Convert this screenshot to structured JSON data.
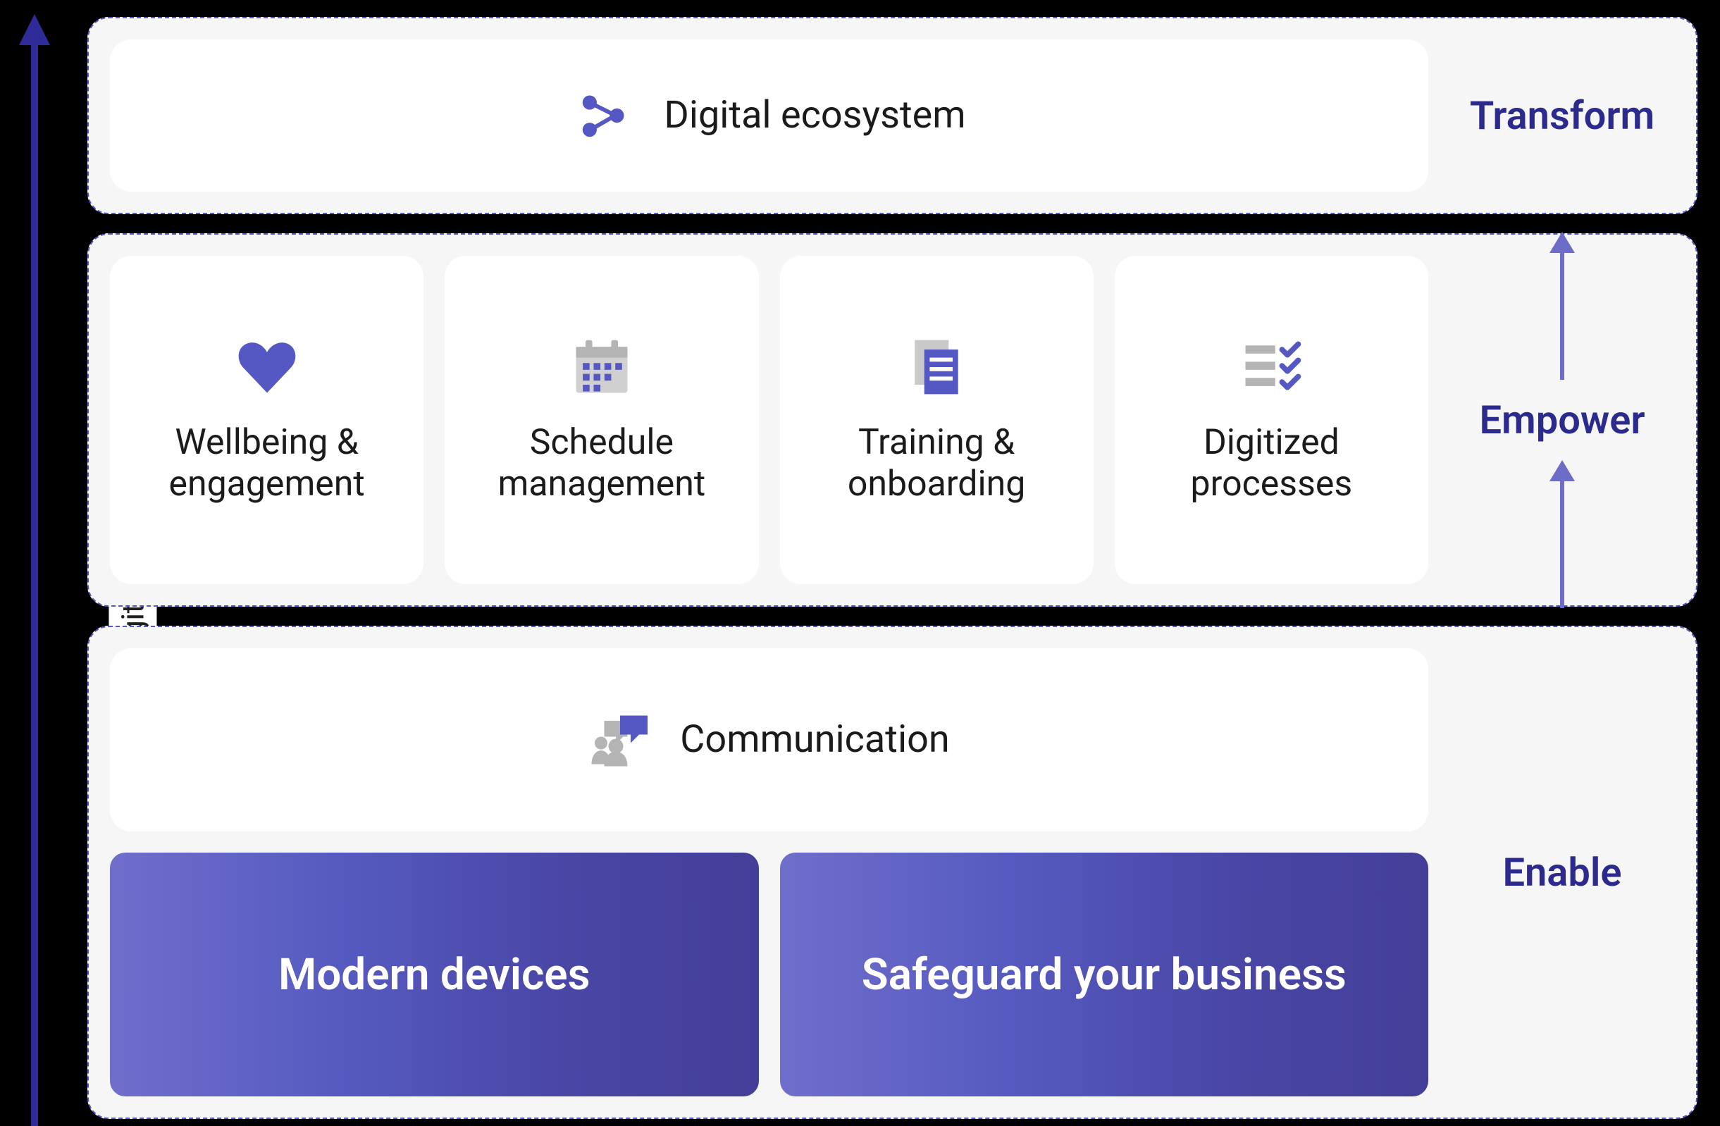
{
  "axis": {
    "label": "Digital maturity"
  },
  "layers": {
    "transform": {
      "label": "Transform",
      "card": {
        "title": "Digital ecosystem",
        "icon": "share-nodes-icon"
      }
    },
    "empower": {
      "label": "Empower",
      "cards": [
        {
          "title": "Wellbeing & engagement",
          "icon": "heart-icon"
        },
        {
          "title": "Schedule management",
          "icon": "calendar-icon"
        },
        {
          "title": "Training & onboarding",
          "icon": "document-icon"
        },
        {
          "title": "Digitized processes",
          "icon": "checklist-icon"
        }
      ]
    },
    "enable": {
      "label": "Enable",
      "card": {
        "title": "Communication",
        "icon": "chat-icon"
      },
      "bars": [
        {
          "title": "Modern devices"
        },
        {
          "title": "Safeguard your business"
        }
      ]
    }
  },
  "colors": {
    "indigo": "#5558C2",
    "indigo_dark": "#2F2C99",
    "indigo_light": "#6D6CC7",
    "gray": "#B4B4B4",
    "panel_bg": "#F6F6F6"
  }
}
